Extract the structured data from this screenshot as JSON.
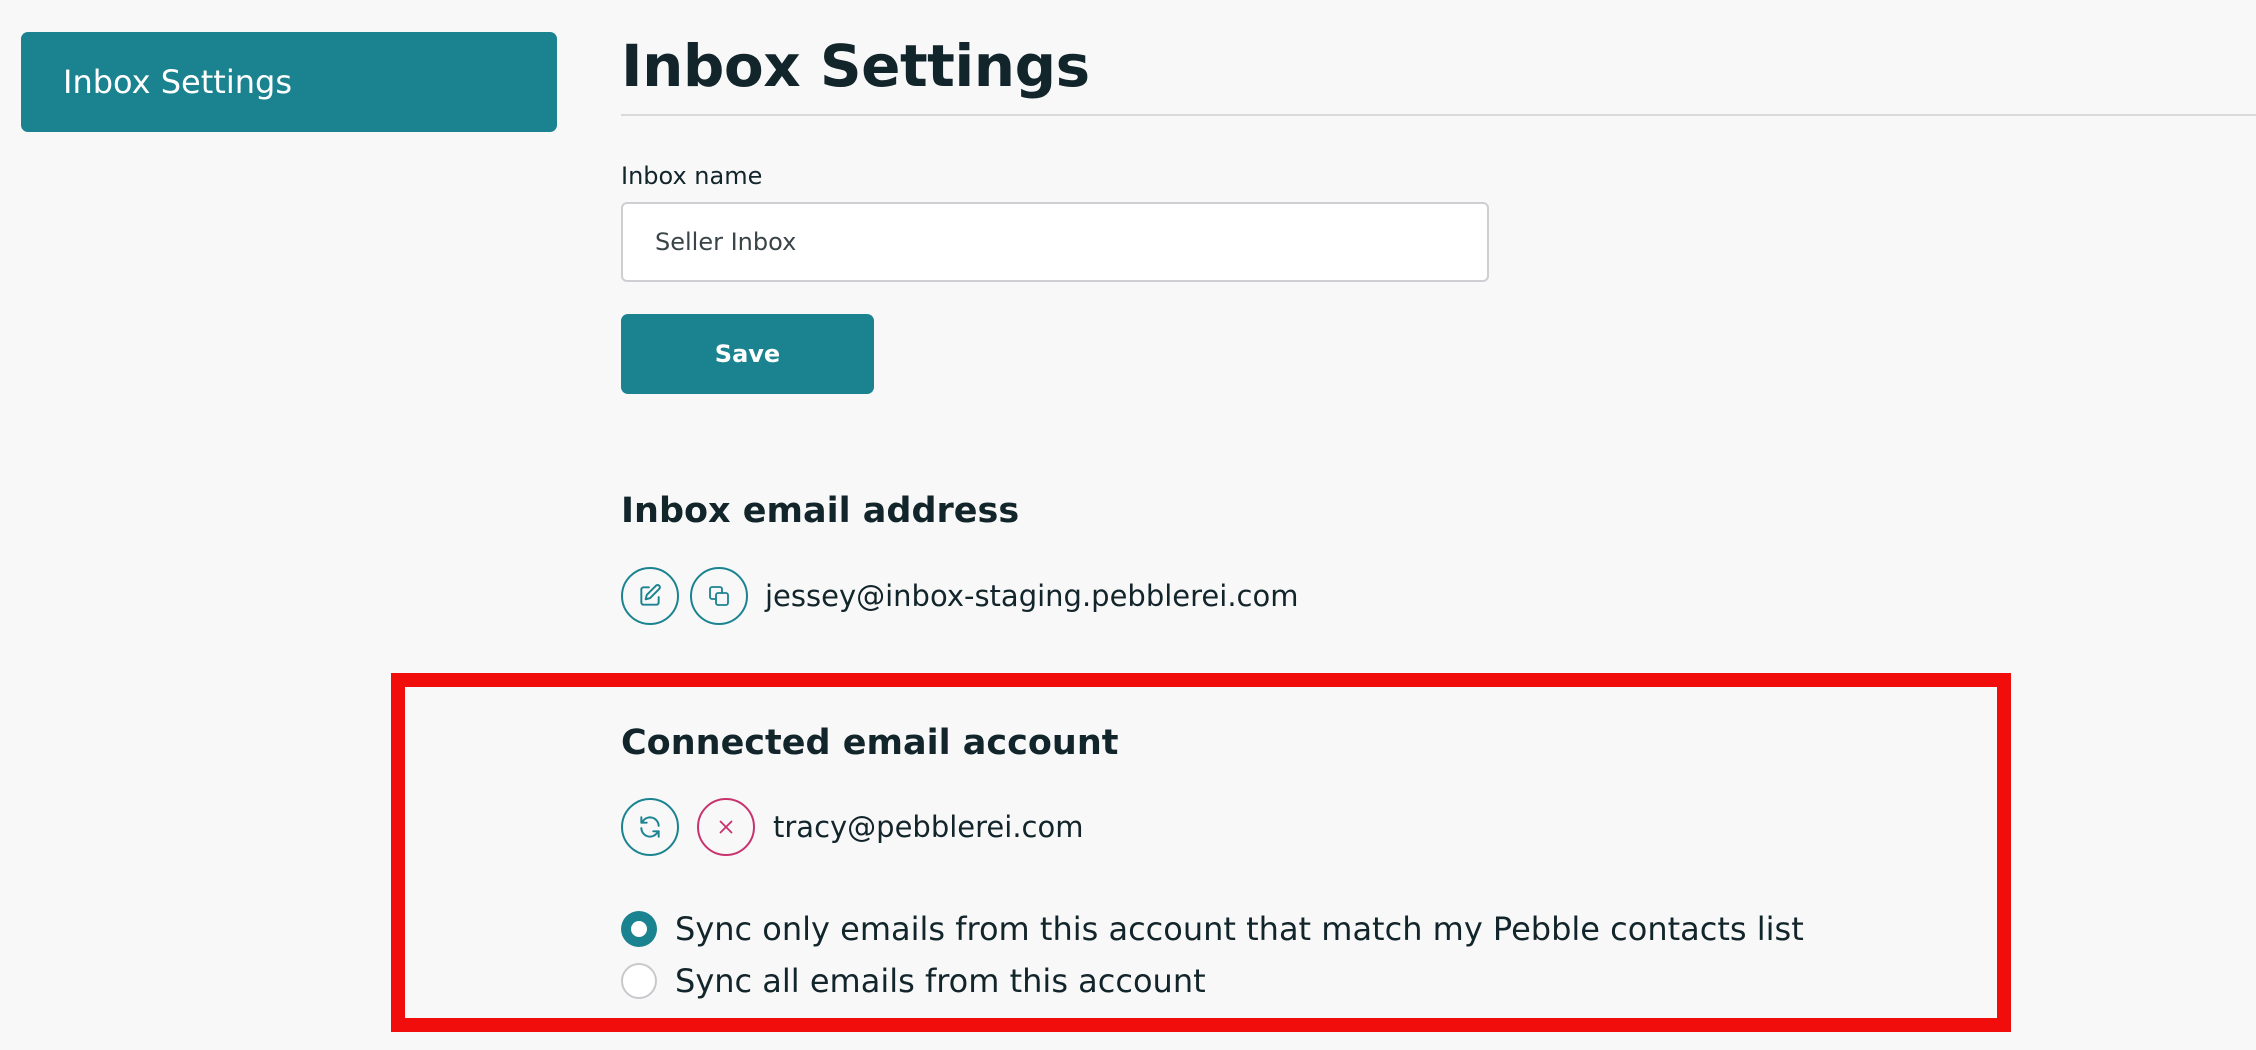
{
  "sidebar": {
    "items": [
      {
        "label": "Inbox Settings",
        "active": true
      }
    ]
  },
  "page": {
    "title": "Inbox Settings"
  },
  "inbox_name": {
    "label": "Inbox name",
    "value": "Seller Inbox"
  },
  "save": {
    "label": "Save"
  },
  "inbox_email": {
    "heading": "Inbox email address",
    "address": "jessey@inbox-staging.pebblerei.com",
    "actions": [
      "edit-icon",
      "copy-icon"
    ]
  },
  "connected": {
    "heading": "Connected email account",
    "address": "tracy@pebblerei.com",
    "actions": [
      "refresh-icon",
      "close-icon"
    ],
    "sync_options": [
      {
        "label": "Sync only emails from this account that match my Pebble contacts list",
        "selected": true
      },
      {
        "label": "Sync all emails from this account",
        "selected": false
      }
    ]
  },
  "colors": {
    "accent": "#1b8390",
    "danger": "#c8336e",
    "highlight": "#f20d0d",
    "background": "#f8f8f9"
  }
}
